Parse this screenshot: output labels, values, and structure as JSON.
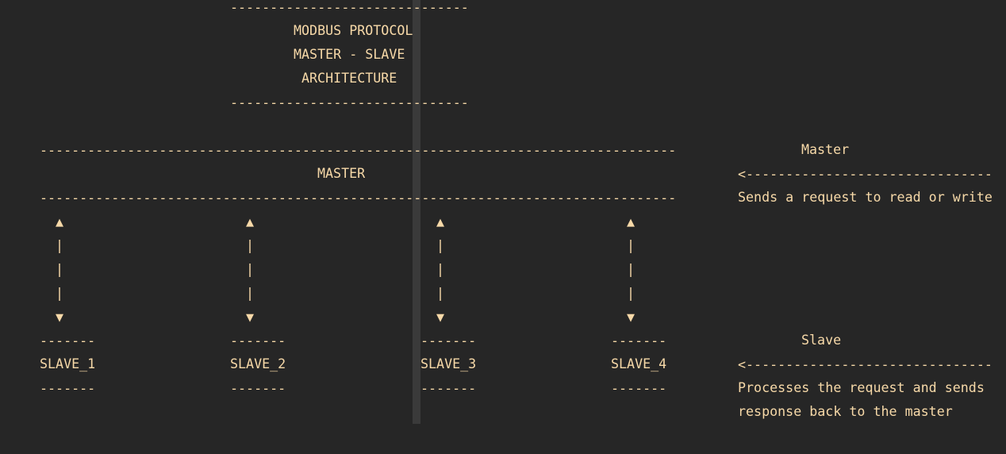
{
  "title": {
    "rule": "------------------------------",
    "line1": "MODBUS PROTOCOL",
    "line2": "MASTER - SLAVE",
    "line3": "ARCHITECTURE"
  },
  "master_box": {
    "rule": "--------------------------------------------------------------------------------",
    "label": "MASTER"
  },
  "connectors": {
    "up": "▲",
    "pipe": "|",
    "down": "▼"
  },
  "slaves": {
    "rule": "-------",
    "items": [
      "SLAVE_1",
      "SLAVE_2",
      "SLAVE_3",
      "SLAVE_4"
    ]
  },
  "annotations": {
    "master_title": "Master",
    "master_arrow": "<-------------------------------",
    "master_desc": "Sends a request to read or write",
    "slave_title": "Slave",
    "slave_arrow": "<-------------------------------",
    "slave_desc_1": "Processes the request and sends",
    "slave_desc_2": "response back to the master"
  }
}
